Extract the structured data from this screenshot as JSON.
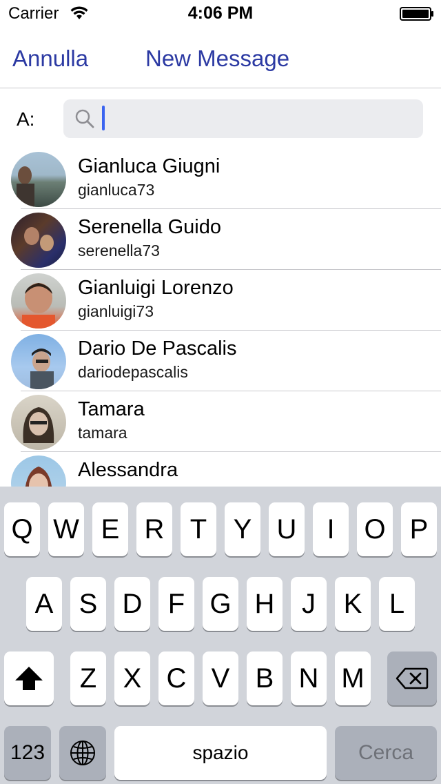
{
  "status_bar": {
    "carrier": "Carrier",
    "time": "4:06 PM"
  },
  "nav": {
    "cancel_label": "Annulla",
    "title": "New Message"
  },
  "to_field": {
    "label": "A:",
    "value": ""
  },
  "contacts": [
    {
      "name": "Gianluca Giugni",
      "username": "gianluca73"
    },
    {
      "name": "Serenella Guido",
      "username": "serenella73"
    },
    {
      "name": "Gianluigi Lorenzo",
      "username": "gianluigi73"
    },
    {
      "name": "Dario De Pascalis",
      "username": "dariodepascalis"
    },
    {
      "name": "Tamara",
      "username": "tamara"
    },
    {
      "name": "Alessandra",
      "username": ""
    }
  ],
  "keyboard": {
    "row1": [
      "Q",
      "W",
      "E",
      "R",
      "T",
      "Y",
      "U",
      "I",
      "O",
      "P"
    ],
    "row2": [
      "A",
      "S",
      "D",
      "F",
      "G",
      "H",
      "J",
      "K",
      "L"
    ],
    "row3": [
      "Z",
      "X",
      "C",
      "V",
      "B",
      "N",
      "M"
    ],
    "numbers_label": "123",
    "space_label": "spazio",
    "search_label": "Cerca"
  },
  "colors": {
    "accent": "#2c3aa3",
    "cursor": "#3b64f0",
    "keyboard_bg": "#d1d4da"
  },
  "icons": {
    "search": "search-icon",
    "shift": "shift-icon",
    "backspace": "backspace-icon",
    "globe": "globe-icon",
    "wifi": "wifi-icon",
    "battery": "battery-icon"
  }
}
